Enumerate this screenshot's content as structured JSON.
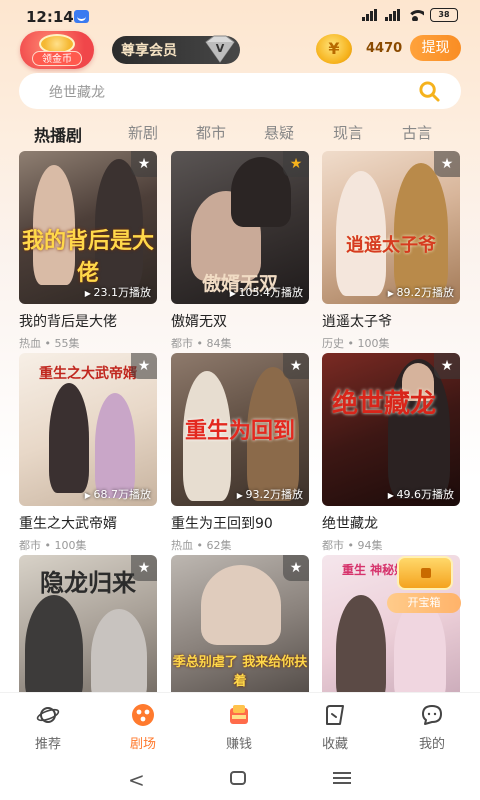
{
  "status_bar": {
    "time": "12:14",
    "battery": "38",
    "signal_label": "HD"
  },
  "header": {
    "gold_badge_label": "领金币",
    "vip_label": "尊享会员",
    "coin_count": "4470",
    "coin_symbol": "¥",
    "withdraw_label": "提现"
  },
  "search": {
    "placeholder": "绝世藏龙"
  },
  "tabs": [
    {
      "label": "热播剧",
      "active": true
    },
    {
      "label": "新剧"
    },
    {
      "label": "都市"
    },
    {
      "label": "悬疑"
    },
    {
      "label": "现言"
    },
    {
      "label": "古言"
    }
  ],
  "dramas": [
    {
      "title": "我的背后是大佬",
      "meta": "热血 • 55集",
      "plays": "23.1万播放",
      "poster_text": "我的背后是大佬",
      "favorited": false
    },
    {
      "title": "傲婿无双",
      "meta": "都市 • 84集",
      "plays": "105.4万播放",
      "poster_text": "傲婿无双",
      "favorited": true
    },
    {
      "title": "逍遥太子爷",
      "meta": "历史 • 100集",
      "plays": "89.2万播放",
      "poster_text": "逍遥太子爷",
      "favorited": false
    },
    {
      "title": "重生之大武帝婿",
      "meta": "都市 • 100集",
      "plays": "68.7万播放",
      "poster_text": "重生之大武帝婿",
      "favorited": false
    },
    {
      "title": "重生为王回到90",
      "meta": "热血 • 62集",
      "plays": "93.2万播放",
      "poster_text": "重生为回到",
      "favorited": false
    },
    {
      "title": "绝世藏龙",
      "meta": "都市 • 94集",
      "plays": "49.6万播放",
      "poster_text": "绝世藏龙",
      "favorited": false
    },
    {
      "title": "",
      "meta": "",
      "plays": "",
      "poster_text": "隐龙归来",
      "favorited": false
    },
    {
      "title": "",
      "meta": "",
      "plays": "",
      "poster_text": "季总别虐了 我来给你扶着",
      "favorited": false
    },
    {
      "title": "",
      "meta": "",
      "plays": "",
      "poster_text": "重生 神秘娇妻",
      "favorited": false
    }
  ],
  "treasure": {
    "label": "开宝箱"
  },
  "bottom_nav": [
    {
      "label": "推荐"
    },
    {
      "label": "剧场",
      "active": true
    },
    {
      "label": "赚钱"
    },
    {
      "label": "收藏"
    },
    {
      "label": "我的"
    }
  ],
  "colors": {
    "accent": "#ff7a2e",
    "coin": "#f6b21c",
    "vip_bg": "#2c2c2c"
  }
}
